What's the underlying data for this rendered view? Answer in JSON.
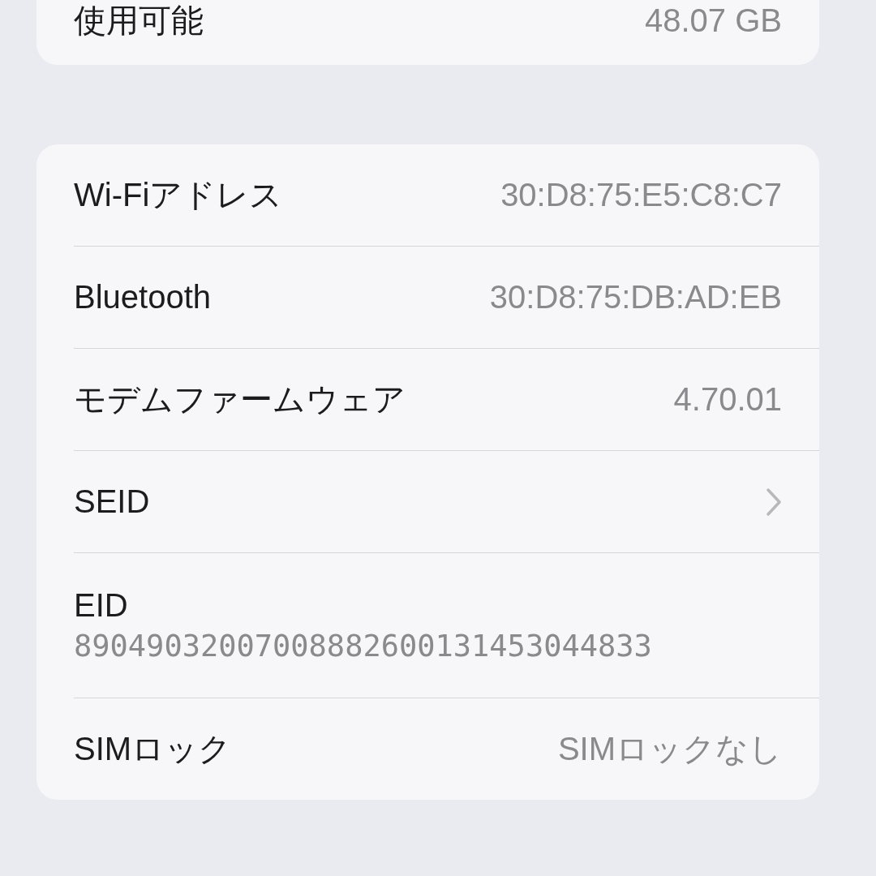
{
  "storage_card": {
    "rows": [
      {
        "kind": "value",
        "label": "使用可能",
        "value": "48.07 GB"
      }
    ]
  },
  "info_card": {
    "rows": [
      {
        "kind": "value",
        "label": "Wi-Fiアドレス",
        "value": "30:D8:75:E5:C8:C7"
      },
      {
        "kind": "value",
        "label": "Bluetooth",
        "value": "30:D8:75:DB:AD:EB"
      },
      {
        "kind": "value",
        "label": "モデムファームウェア",
        "value": "4.70.01"
      },
      {
        "kind": "chevron",
        "label": "SEID"
      },
      {
        "kind": "stacked",
        "label": "EID",
        "value": "89049032007008882600131453044833"
      },
      {
        "kind": "value",
        "label": "SIMロック",
        "value": "SIMロックなし"
      }
    ]
  }
}
